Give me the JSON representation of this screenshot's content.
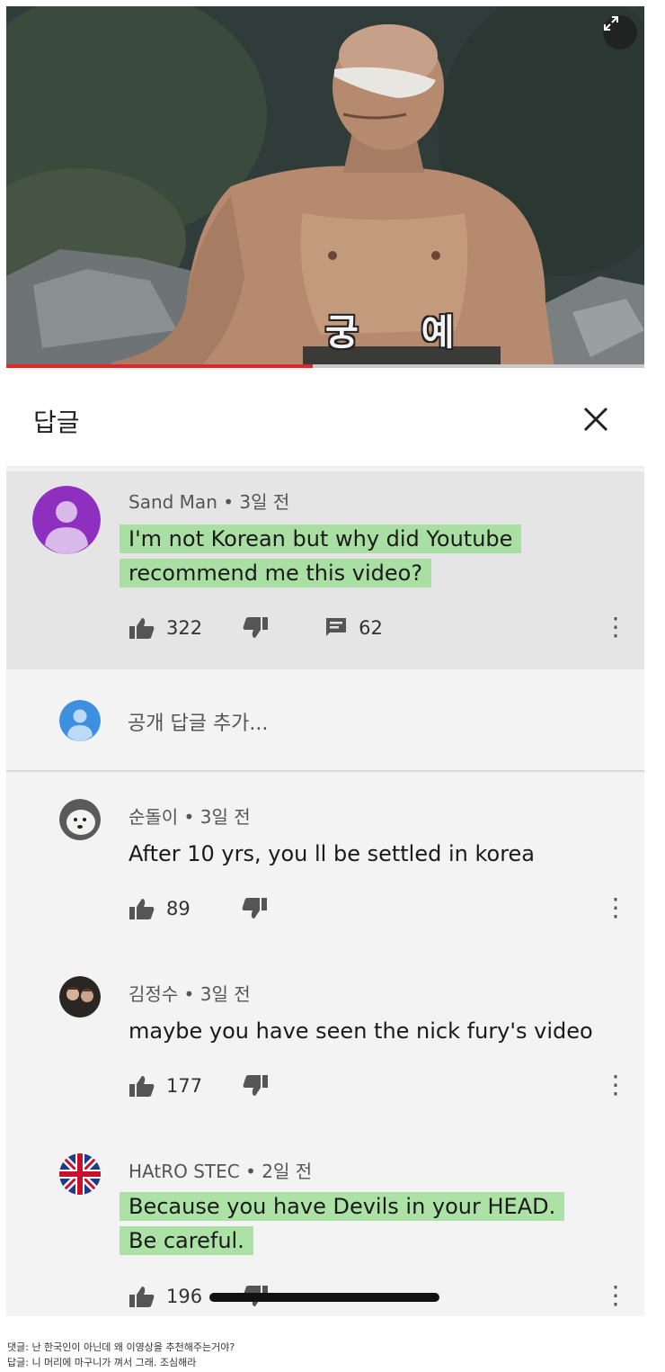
{
  "video": {
    "caption": "궁 예",
    "progress": 0.48
  },
  "header": {
    "title": "답글"
  },
  "main_comment": {
    "author": "Sand Man",
    "time": "3일 전",
    "text": "I'm not Korean but why did Youtube recommend me this video?",
    "likes": "322",
    "replies": "62",
    "avatar_color": "#8e2fbf"
  },
  "add_reply": {
    "placeholder": "공개 답글 추가..."
  },
  "replies": [
    {
      "author": "순돌이",
      "time": "3일 전",
      "text": "After 10 yrs, you ll be settled in korea",
      "likes": "89"
    },
    {
      "author": "김정수",
      "time": "3일 전",
      "text": "maybe you have seen the nick fury's video",
      "likes": "177"
    },
    {
      "author": "HAtRO STEC",
      "time": "2일 전",
      "text": "Because you have Devils in your HEAD. Be careful.",
      "likes": "196"
    }
  ],
  "footer": {
    "line1": "댓글: 난 한국인이 아닌데 왜 이영상을 추천해주는거야?",
    "line2": "답글: 니 머리에 마구니가 껴서 그래. 조심해라"
  },
  "colors": {
    "highlight": "#96dc8c",
    "progress": "#e0262a",
    "main_bg": "#e5e5e5",
    "reply_bg": "#f3f3f3"
  }
}
